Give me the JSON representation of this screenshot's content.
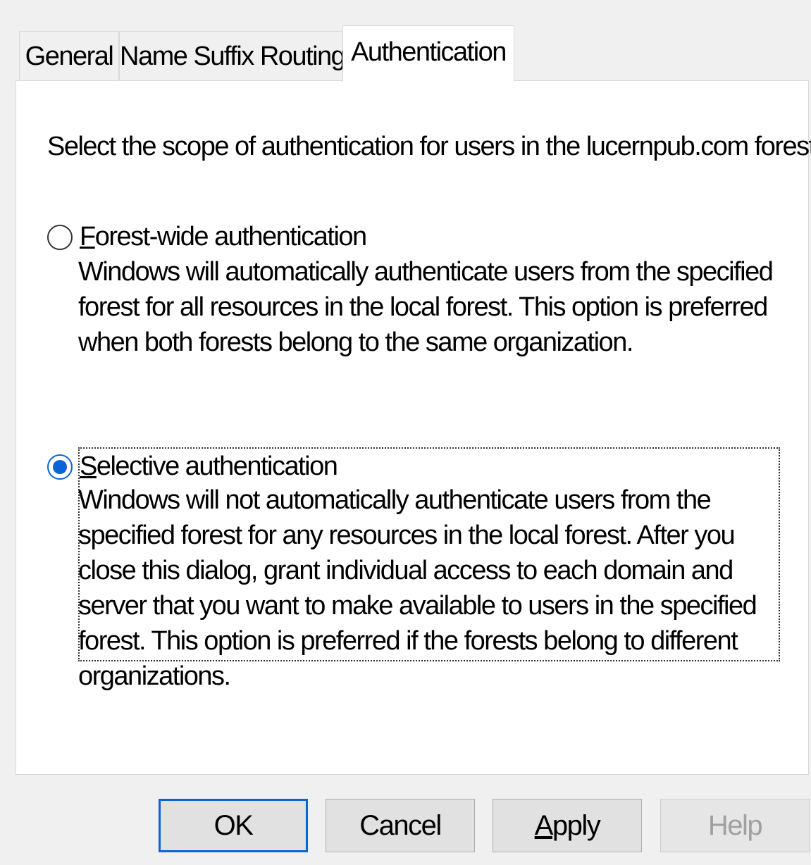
{
  "tabs": [
    {
      "label": "General",
      "active": false
    },
    {
      "label": "Name Suffix Routing",
      "active": false
    },
    {
      "label": "Authentication",
      "active": true
    }
  ],
  "panel": {
    "intro": "Select the scope of authentication for users in the lucernpub.com forest."
  },
  "options": [
    {
      "title_first_letter": "F",
      "title_rest": "orest-wide authentication",
      "description": "Windows will automatically authenticate users from the specified forest for all resources in the local forest. This option is preferred when both forests belong to the same organization.",
      "selected": false
    },
    {
      "title_first_letter": "S",
      "title_rest": "elective authentication",
      "description": "Windows will not automatically authenticate users from the specified forest for any resources in the local forest. After you close this dialog, grant individual access to each domain and server that you want to make available to users in the specified forest. This option is preferred if the forests belong to different organizations.",
      "selected": true
    }
  ],
  "buttons": {
    "ok": "OK",
    "cancel": "Cancel",
    "apply_first_letter": "A",
    "apply_rest": "pply",
    "help": "Help"
  },
  "colors": {
    "accent": "#0a64d6",
    "panel_bg": "#ffffff",
    "dialog_bg": "#f0f0f0",
    "disabled_text": "#a0a0a0"
  }
}
